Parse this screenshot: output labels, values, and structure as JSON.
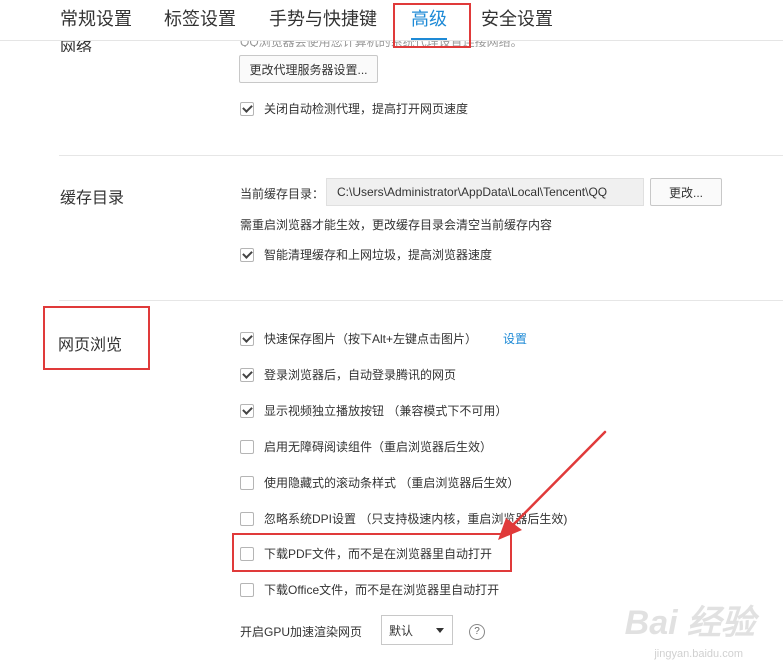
{
  "tabs": [
    {
      "label": "常规设置",
      "active": false
    },
    {
      "label": "标签设置",
      "active": false
    },
    {
      "label": "手势与快捷键",
      "active": false
    },
    {
      "label": "高级",
      "active": true
    },
    {
      "label": "安全设置",
      "active": false
    }
  ],
  "network": {
    "title": "网络",
    "truncated_text": "QQ浏览器会使用您计算机的系统代理设置连接网络。",
    "proxy_button": "更改代理服务器设置...",
    "auto_detect_label": "关闭自动检测代理，提高打开网页速度",
    "auto_detect_checked": true
  },
  "cache": {
    "title": "缓存目录",
    "current_label": "当前缓存目录：",
    "path": "C:\\Users\\Administrator\\AppData\\Local\\Tencent\\QQ",
    "change_button": "更改...",
    "note": "需重启浏览器才能生效，更改缓存目录会清空当前缓存内容",
    "smart_clean_label": "智能清理缓存和上网垃圾，提高浏览器速度",
    "smart_clean_checked": true
  },
  "browsing": {
    "title": "网页浏览",
    "settings_link": "设置",
    "options": [
      {
        "label": "快速保存图片（按下Alt+左键点击图片）",
        "checked": true
      },
      {
        "label": "登录浏览器后，自动登录腾讯的网页",
        "checked": true
      },
      {
        "label": "显示视频独立播放按钮 （兼容模式下不可用）",
        "checked": true
      },
      {
        "label": "启用无障碍阅读组件（重启浏览器后生效）",
        "checked": false
      },
      {
        "label": "使用隐藏式的滚动条样式 （重启浏览器后生效）",
        "checked": false
      },
      {
        "label": "忽略系统DPI设置 （只支持极速内核，重启浏览器后生效)",
        "checked": false
      },
      {
        "label": "下载PDF文件，而不是在浏览器里自动打开",
        "checked": false
      },
      {
        "label": "下载Office文件，而不是在浏览器里自动打开",
        "checked": false
      }
    ],
    "gpu_label": "开启GPU加速渲染网页",
    "gpu_value": "默认",
    "help_glyph": "?"
  },
  "watermark": {
    "main": "Bai 经验",
    "sub": "jingyan.baidu.com"
  },
  "colors": {
    "accent": "#1e8ad6",
    "annotation_red": "#e03a3a"
  },
  "icons": {
    "checkbox": "checkbox-icon",
    "dropdown": "chevron-down-icon",
    "help": "help-icon"
  }
}
